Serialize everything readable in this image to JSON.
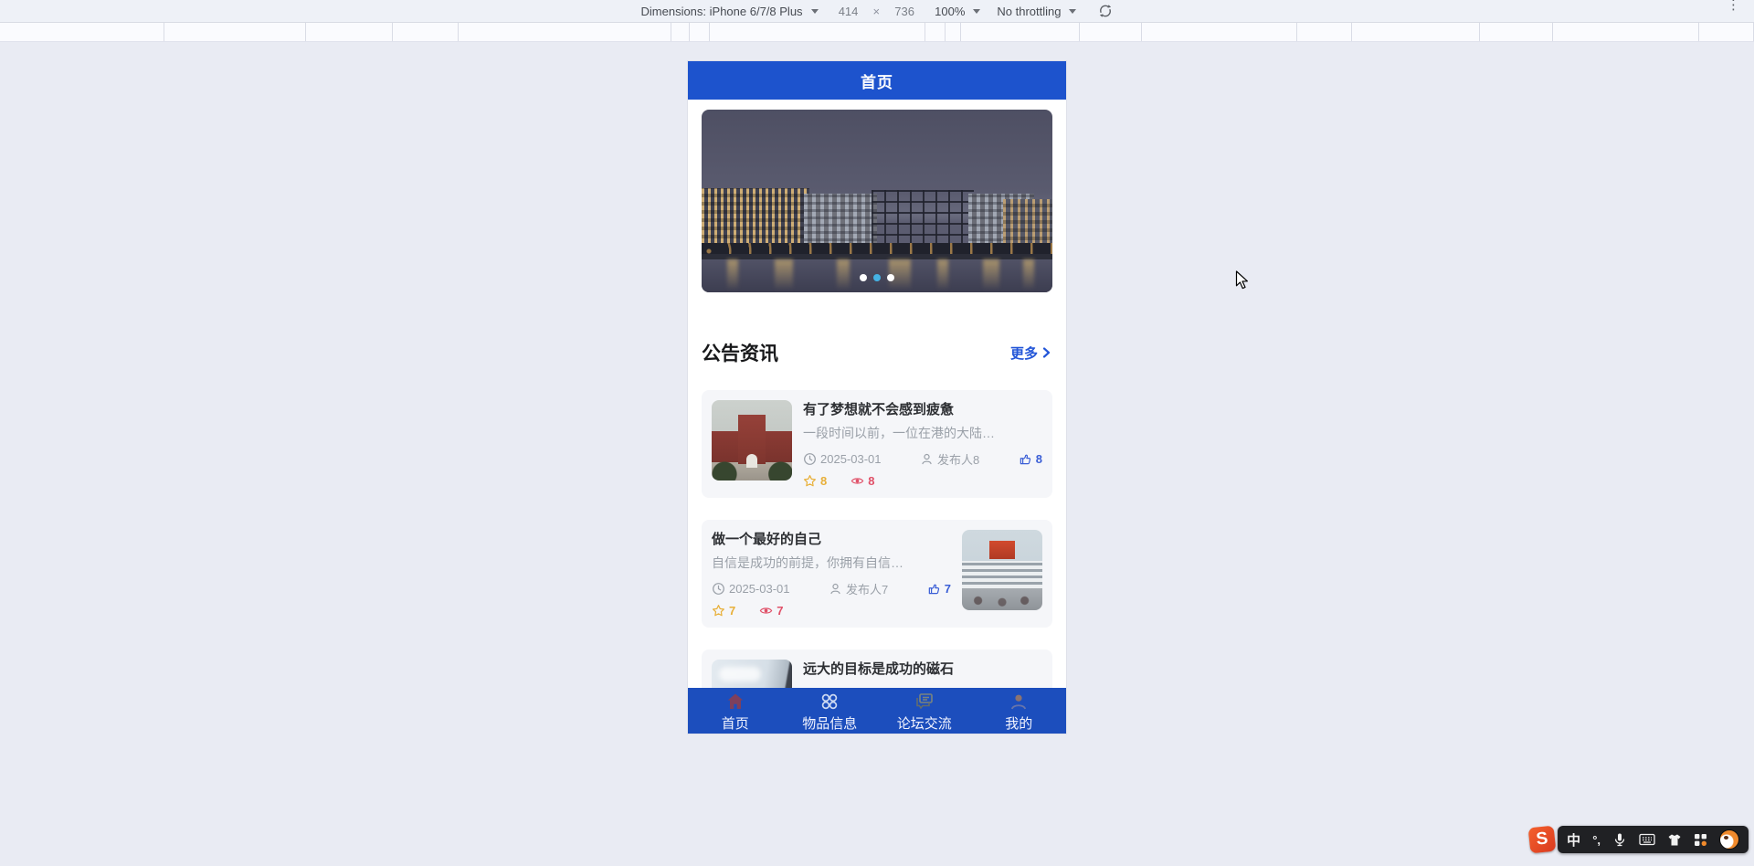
{
  "devtools": {
    "dimensions_label": "Dimensions: iPhone 6/7/8 Plus",
    "width_value": "414",
    "times_sign": "×",
    "height_value": "736",
    "zoom_value": "100%",
    "throttling_value": "No throttling",
    "menu_glyph": "⋮"
  },
  "app": {
    "header_title": "首页",
    "carousel": {
      "dot_count": 3,
      "active_dot": 1,
      "active_color": "#45b2e4",
      "inactive_color": "#ffffff"
    },
    "section": {
      "title": "公告资讯",
      "more_label": "更多"
    },
    "articles": [
      {
        "title": "有了梦想就不会感到疲惫",
        "excerpt": "一段时间以前，一位在港的大陆…",
        "date": "2025-03-01",
        "publisher": "发布人8",
        "likes": "8",
        "stars": "8",
        "views": "8",
        "image_side": "left",
        "thumb": "thumb1"
      },
      {
        "title": "做一个最好的自己",
        "excerpt": "自信是成功的前提，你拥有自信…",
        "date": "2025-03-01",
        "publisher": "发布人7",
        "likes": "7",
        "stars": "7",
        "views": "7",
        "image_side": "right",
        "thumb": "thumb2"
      },
      {
        "title": "远大的目标是成功的磁石",
        "image_side": "left",
        "thumb": "thumb3"
      }
    ],
    "tabbar": [
      {
        "label": "首页",
        "icon": "home-icon"
      },
      {
        "label": "物品信息",
        "icon": "grid-icon"
      },
      {
        "label": "论坛交流",
        "icon": "forum-icon"
      },
      {
        "label": "我的",
        "icon": "profile-icon"
      }
    ]
  },
  "ime": {
    "mode_label": "中",
    "punctuation_label": "°,",
    "logo_letter": "S",
    "icons": [
      "mode",
      "punctuation",
      "mic-icon",
      "keyboard-icon",
      "skin-icon",
      "toolbox-icon",
      "emoji-icon"
    ]
  },
  "colors": {
    "header_blue": "#1d53cd",
    "tabbar_blue": "#1c4ebd",
    "accent_blue": "#2356d8",
    "like_blue": "#3a5ed6",
    "star_gold": "#e8b03a",
    "view_red": "#e05068",
    "text_gray": "#9aa0a8"
  }
}
